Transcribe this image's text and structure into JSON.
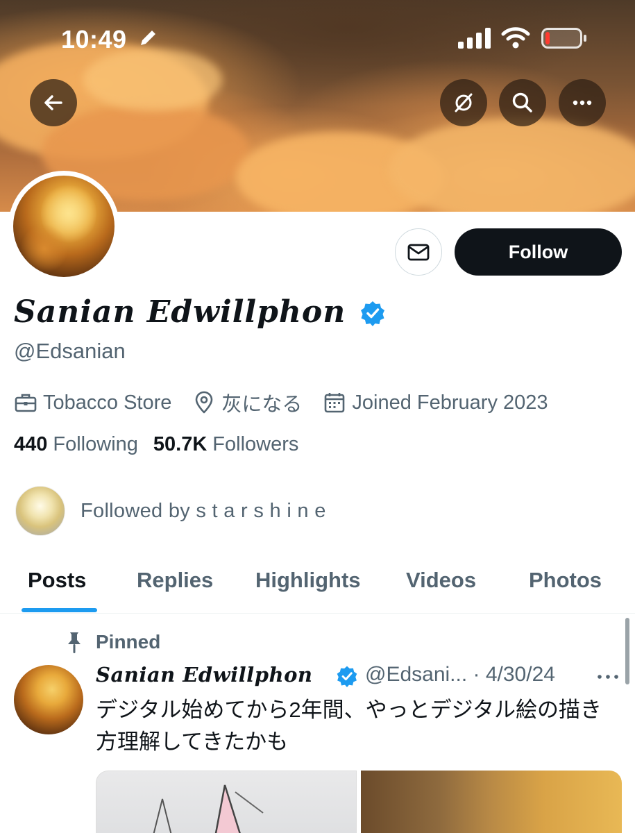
{
  "status_bar": {
    "time": "10:49"
  },
  "colors": {
    "accent": "#1d9bf0",
    "text_primary": "#0f1419",
    "text_secondary": "#536471",
    "follow_bg": "#0f1419"
  },
  "actions": {
    "follow_label": "Follow"
  },
  "profile": {
    "display_name": "Sanian Edwillphon",
    "handle": "@Edsanian",
    "category": "Tobacco Store",
    "location": "灰になる",
    "joined": "Joined February 2023",
    "following_count": "440",
    "following_label": "Following",
    "followers_count": "50.7K",
    "followers_label": "Followers",
    "followed_by": "Followed by s t a r s h i n e"
  },
  "tabs": [
    {
      "label": "Posts",
      "active": true
    },
    {
      "label": "Replies",
      "active": false
    },
    {
      "label": "Highlights",
      "active": false
    },
    {
      "label": "Videos",
      "active": false
    },
    {
      "label": "Photos",
      "active": false
    }
  ],
  "pinned_post": {
    "pinned_label": "Pinned",
    "author_name": "Sanian Edwillphon",
    "author_handle_date": "@Edsani... · 4/30/24",
    "text": "デジタル始めてから2年間、やっとデジタル絵の描き方理解してきたかも"
  }
}
